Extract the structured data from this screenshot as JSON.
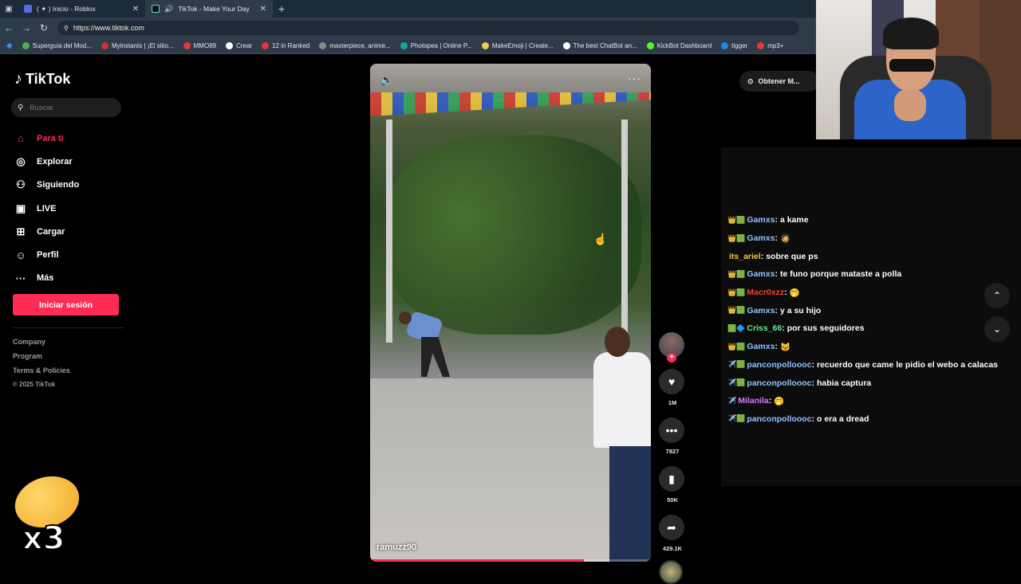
{
  "browser": {
    "tabs": [
      {
        "title": "( ✦ ) Inicio - Roblox",
        "active": false
      },
      {
        "title": "TikTok - Make Your Day",
        "active": true
      }
    ],
    "new_tab": "+",
    "url": "https://www.tiktok.com",
    "bookmarks": [
      {
        "label": "Superguía del Mod...",
        "color": "#4caf50"
      },
      {
        "label": "Myinstants | ¡El sitio...",
        "color": "#d32f2f"
      },
      {
        "label": "MMO89",
        "color": "#e53935"
      },
      {
        "label": "Crear",
        "color": "#ffffff"
      },
      {
        "label": "12 in Ranked",
        "color": "#e53935"
      },
      {
        "label": "masterpiece, anime...",
        "color": "#888888"
      },
      {
        "label": "Photopea | Online P...",
        "color": "#18a497"
      },
      {
        "label": "MakeEmoji | Create...",
        "color": "#f2c94c"
      },
      {
        "label": "The best ChatBot an...",
        "color": "#ffffff"
      },
      {
        "label": "KickBot Dashboard",
        "color": "#53fc18"
      },
      {
        "label": "tigger",
        "color": "#1e88e5"
      },
      {
        "label": "mp3+",
        "color": "#e53935"
      }
    ]
  },
  "sidebar": {
    "logo": "TikTok",
    "search_placeholder": "Buscar",
    "items": [
      {
        "label": "Para ti",
        "icon": "home-icon",
        "glyph": "⌂",
        "active": true
      },
      {
        "label": "Explorar",
        "icon": "compass-icon",
        "glyph": "◎",
        "active": false
      },
      {
        "label": "Siguiendo",
        "icon": "following-icon",
        "glyph": "⚇",
        "active": false
      },
      {
        "label": "LIVE",
        "icon": "live-icon",
        "glyph": "▣",
        "active": false
      },
      {
        "label": "Cargar",
        "icon": "upload-icon",
        "glyph": "⊞",
        "active": false
      },
      {
        "label": "Perfil",
        "icon": "profile-icon",
        "glyph": "☺",
        "active": false
      },
      {
        "label": "Más",
        "icon": "more-icon",
        "glyph": "···",
        "active": false
      }
    ],
    "login_label": "Iniciar sesión",
    "footer": {
      "company": "Company",
      "program": "Program",
      "terms": "Terms & Policies",
      "copyright": "© 2025 TikTok"
    }
  },
  "sticker": {
    "multiplier": "x3"
  },
  "video": {
    "author": "ramuzz90",
    "progress": 0.76
  },
  "actions": {
    "likes": "1M",
    "comments": "7827",
    "saves": "50K",
    "shares": "429.1K"
  },
  "top_right": {
    "get_app_label": "Obtener M..."
  },
  "chat": {
    "messages": [
      {
        "badge": "👑🟩",
        "user": "Gamxs",
        "user_color": "#8fc3ff",
        "text": "a kame"
      },
      {
        "badge": "👑🟩",
        "user": "Gamxs",
        "user_color": "#8fc3ff",
        "text": "🧔"
      },
      {
        "badge": "",
        "user": "its_ariel",
        "user_color": "#f5c542",
        "text": "sobre que ps"
      },
      {
        "badge": "👑🟩",
        "user": "Gamxs",
        "user_color": "#8fc3ff",
        "text": "te funo porque mataste a polla"
      },
      {
        "badge": "👑🟩",
        "user": "Macr0xzz",
        "user_color": "#ff3b3b",
        "text": "🤭"
      },
      {
        "badge": "👑🟩",
        "user": "Gamxs",
        "user_color": "#8fc3ff",
        "text": "y a su hijo"
      },
      {
        "badge": "🟩🔷",
        "user": "Criss_66",
        "user_color": "#5cf08a",
        "text": "por sus seguidores"
      },
      {
        "badge": "👑🟩",
        "user": "Gamxs",
        "user_color": "#8fc3ff",
        "text": "🐱"
      },
      {
        "badge": "✈️🟩",
        "user": "panconpolloooc",
        "user_color": "#8fc3ff",
        "text": "recuerdo que came le pidio el webo a calacas"
      },
      {
        "badge": "✈️🟩",
        "user": "panconpolloooc",
        "user_color": "#8fc3ff",
        "text": "habia captura"
      },
      {
        "badge": "✈️",
        "user": "Milanila",
        "user_color": "#d37cff",
        "text": "🤭"
      },
      {
        "badge": "✈️🟩",
        "user": "panconpolloooc",
        "user_color": "#8fc3ff",
        "text": "o era a dread"
      }
    ]
  },
  "colors": {
    "accent": "#fe2c55",
    "background": "#000000"
  }
}
